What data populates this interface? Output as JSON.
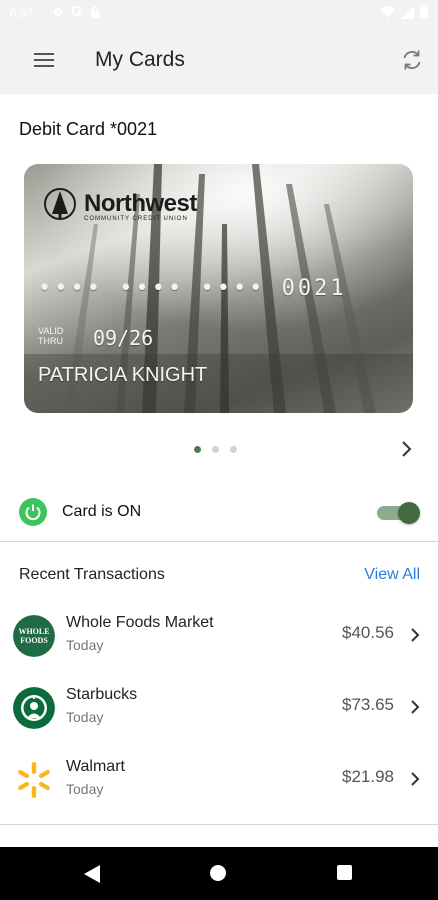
{
  "status_bar": {
    "time": "6:57",
    "icons_left": [
      "gear-icon",
      "google-icon",
      "lock-icon"
    ],
    "icons_right": [
      "wifi-icon",
      "signal-icon",
      "battery-icon"
    ]
  },
  "app_bar": {
    "title": "My Cards",
    "menu_icon": "hamburger-menu-icon",
    "refresh_icon": "refresh-icon"
  },
  "card_section": {
    "title": "Debit Card *0021",
    "card": {
      "brand": "Northwest",
      "brand_sub": "COMMUNITY CREDIT UNION",
      "masked_number": "•••• •••• •••• 0021",
      "valid_label": "VALID THRU",
      "expiry": "09/26",
      "holder": "PATRICIA KNIGHT"
    },
    "pager": {
      "count": 3,
      "active": 0
    }
  },
  "card_status": {
    "label": "Card is ON",
    "enabled": true
  },
  "transactions": {
    "title": "Recent Transactions",
    "view_all": "View All",
    "items": [
      {
        "merchant": "Whole Foods Market",
        "date": "Today",
        "amount": "$40.56",
        "logo_text": "WHOLE FOODS",
        "logo_color": "#1f6b44"
      },
      {
        "merchant": "Starbucks",
        "date": "Today",
        "amount": "$73.65",
        "logo_text": "",
        "logo_color": "#0b6b3a"
      },
      {
        "merchant": "Walmart",
        "date": "Today",
        "amount": "$21.98",
        "logo_text": "",
        "logo_color": "#f6b81c"
      }
    ]
  },
  "colors": {
    "accent_green": "#426b42",
    "link_blue": "#2b7fd9",
    "power_green": "#3ec45c"
  }
}
